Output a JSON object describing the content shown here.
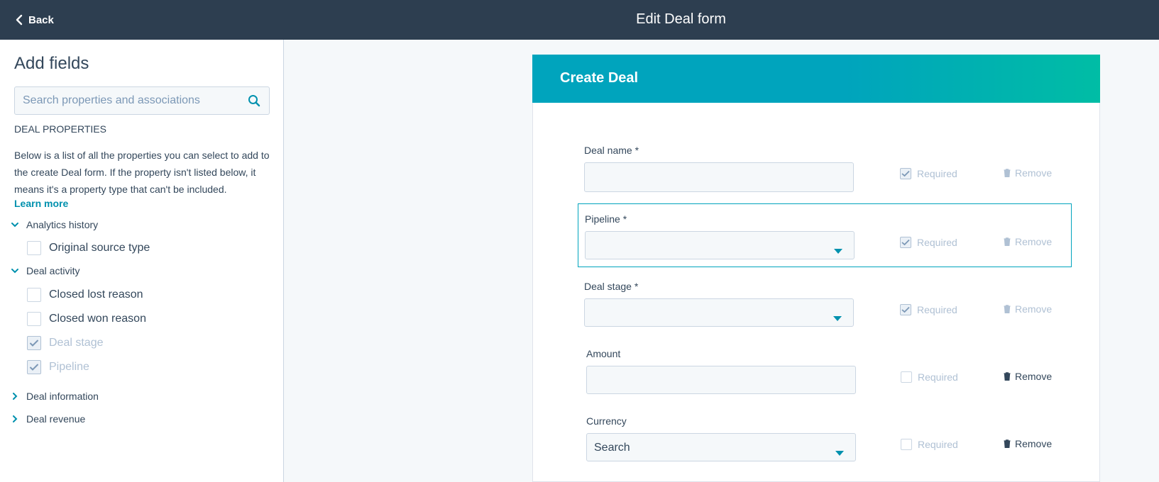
{
  "topbar": {
    "back_label": "Back",
    "title": "Edit Deal form"
  },
  "sidebar": {
    "heading": "Add fields",
    "search_placeholder": "Search properties and associations",
    "section_title": "DEAL PROPERTIES",
    "description": "Below is a list of all the properties you can select to add to the create Deal form. If the property isn't listed below, it means it's a property type that can't be included.",
    "learn_more": "Learn more",
    "groups": [
      {
        "label": "Analytics history",
        "expanded": true,
        "items": [
          {
            "label": "Original source type",
            "checked": false,
            "disabled": false
          }
        ]
      },
      {
        "label": "Deal activity",
        "expanded": true,
        "items": [
          {
            "label": "Closed lost reason",
            "checked": false,
            "disabled": false
          },
          {
            "label": "Closed won reason",
            "checked": false,
            "disabled": false
          },
          {
            "label": "Deal stage",
            "checked": true,
            "disabled": true
          },
          {
            "label": "Pipeline",
            "checked": true,
            "disabled": true
          }
        ]
      },
      {
        "label": "Deal information",
        "expanded": false,
        "items": []
      },
      {
        "label": "Deal revenue",
        "expanded": false,
        "items": []
      }
    ]
  },
  "form": {
    "title": "Create Deal",
    "required_label": "Required",
    "remove_label": "Remove",
    "fields": [
      {
        "label": "Deal name *",
        "type": "text",
        "value": "",
        "required": true,
        "removable": false
      },
      {
        "label": "Pipeline *",
        "type": "select",
        "value": "",
        "required": true,
        "removable": false,
        "focused": true
      },
      {
        "label": "Deal stage *",
        "type": "select",
        "value": "",
        "required": true,
        "removable": false
      },
      {
        "label": "Amount",
        "type": "text",
        "value": "",
        "required": false,
        "removable": true
      },
      {
        "label": "Currency",
        "type": "select",
        "value": "Search",
        "required": false,
        "removable": true
      }
    ]
  },
  "colors": {
    "topbar": "#2d3e50",
    "accent": "#00a4bd",
    "accent_end": "#00bda5",
    "link": "#0091ae",
    "text": "#33475b",
    "muted": "#b0c1d4"
  }
}
